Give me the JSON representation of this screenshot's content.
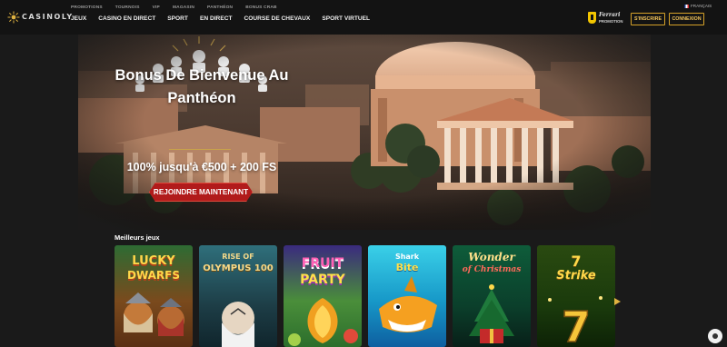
{
  "brand": {
    "logo_text": "CASINOLY"
  },
  "top_links": [
    "PROMOTIONS",
    "TOURNOIS",
    "VIP",
    "MAGASIN",
    "PANTHÉON",
    "BONUS CRAB"
  ],
  "main_nav": [
    "JEUX",
    "CASINO EN DIRECT",
    "SPORT",
    "EN DIRECT",
    "COURSE DE CHEVAUX",
    "SPORT VIRTUEL"
  ],
  "ferrari": {
    "name": "Ferrari",
    "sub": "PROMOTION"
  },
  "language": {
    "label": "FRANÇAIS"
  },
  "buttons": {
    "register": "S'INSCRIRE",
    "login": "CONNEXION"
  },
  "hero": {
    "title_line1": "Bonus De Bienvenue Au",
    "title_line2": "Panthéon",
    "subtitle": "100% jusqu'à €500 + 200 FS",
    "cta": "REJOINDRE MAINTENANT"
  },
  "games_section": {
    "title": "Meilleurs jeux",
    "games": [
      {
        "name": "Lucky Dwarfs",
        "line1": "LUCKY",
        "line2": "DWARFS"
      },
      {
        "name": "Rise of Olympus 100",
        "line1": "RISE OF",
        "line2": "OLYMPUS 100"
      },
      {
        "name": "Fruit Party",
        "line1": "FRUIT",
        "line2": "PARTY"
      },
      {
        "name": "Shark Bite",
        "line1": "Shark",
        "line2": "Bite"
      },
      {
        "name": "Wonder of Christmas",
        "line1": "Wonder",
        "line2": "of Christmas"
      },
      {
        "name": "7 Strike",
        "line1": "7",
        "line2": "Strike"
      }
    ]
  },
  "colors": {
    "gold": "#d6a229",
    "cta_red": "#b11b1b",
    "header_bg": "#131313",
    "page_bg": "#1a1a1a"
  }
}
